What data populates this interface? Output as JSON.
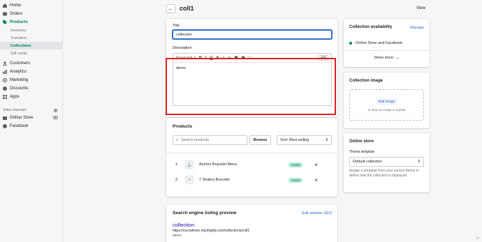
{
  "sidebar": {
    "items": [
      {
        "label": "Home"
      },
      {
        "label": "Orders"
      },
      {
        "label": "Products"
      }
    ],
    "product_subitems": [
      "Inventory",
      "Transfers",
      "Collections",
      "Gift cards"
    ],
    "items2": [
      {
        "label": "Customers"
      },
      {
        "label": "Analytics"
      },
      {
        "label": "Marketing"
      },
      {
        "label": "Discounts"
      },
      {
        "label": "Apps"
      }
    ],
    "sales_channels_title": "Sales channels",
    "channels": [
      "Online Store",
      "Facebook"
    ]
  },
  "header": {
    "title": "coll1",
    "view_label": "View"
  },
  "details": {
    "title_label": "Title",
    "title_value": "collection",
    "description_label": "Description",
    "format_select": "Paragraph",
    "description_text": "demo"
  },
  "products": {
    "title": "Products",
    "search_placeholder": "Search products",
    "browse_label": "Browse",
    "sort_label": "Sort: Best selling",
    "rows": [
      {
        "num": "1.",
        "name": "Anchor Bracelet Mens",
        "status": "Active"
      },
      {
        "num": "2.",
        "name": "7 Shakra Bracelet",
        "status": "Active"
      }
    ]
  },
  "seo": {
    "title": "Search engine listing preview",
    "edit_link": "Edit website SEO",
    "preview_title": "collection",
    "preview_url": "https://csczafreen.myshopify.com/collections/coll1",
    "preview_desc": "demo"
  },
  "availability": {
    "title": "Collection availability",
    "manage_label": "Manage",
    "channel_text": "Online Store and Facebook",
    "show_more": "Show more"
  },
  "image": {
    "title": "Collection image",
    "add_label": "Add image",
    "drop_text": "or drop an image to upload"
  },
  "online_store": {
    "title": "Online store",
    "template_label": "Theme template",
    "template_value": "Default collection",
    "help_text": "Assign a template from your current theme to define how the collection is displayed."
  },
  "colors": {
    "accent": "#008060",
    "link": "#2c6ecb",
    "highlight": "#e01e1e"
  }
}
